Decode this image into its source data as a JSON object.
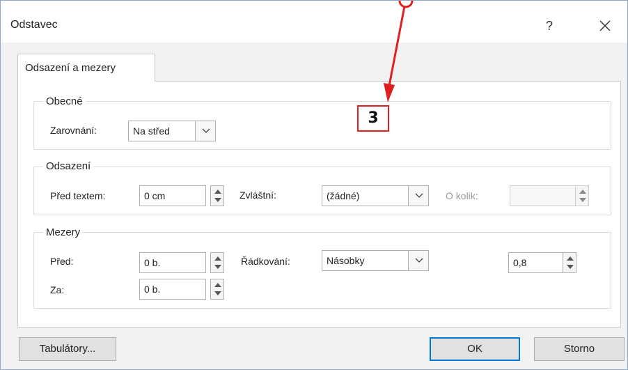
{
  "dialog": {
    "title": "Odstavec",
    "help_label": "?",
    "tab_label": "Odsazení a mezery"
  },
  "general": {
    "heading": "Obecné",
    "alignment_label": "Zarovnání:",
    "alignment_value": "Na střed"
  },
  "indent": {
    "heading": "Odsazení",
    "before_text_label": "Před textem:",
    "before_text_value": "0 cm",
    "special_label": "Zvláštní:",
    "special_value": "(žádné)",
    "by_label": "O kolik:",
    "by_value": ""
  },
  "spacing": {
    "heading": "Mezery",
    "before_label": "Před:",
    "before_value": "0 b.",
    "after_label": "Za:",
    "after_value": "0 b.",
    "line_spacing_label": "Řádkování:",
    "line_spacing_value": "Násobky",
    "at_value": "0,8"
  },
  "buttons": {
    "tabs_label": "Tabulátory...",
    "ok_label": "OK",
    "cancel_label": "Storno"
  },
  "annotation": {
    "callout_number": "3",
    "color": "#e02020"
  },
  "colors": {
    "accent": "#0078d7",
    "border": "#adadad"
  }
}
